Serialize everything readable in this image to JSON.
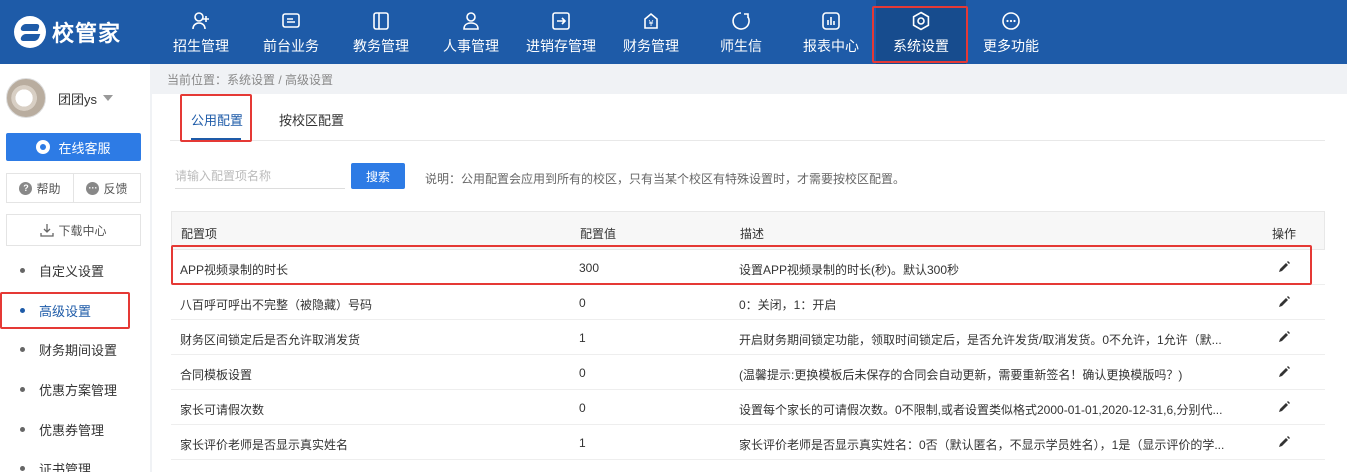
{
  "app": {
    "logo_text": "校管家"
  },
  "nav": {
    "items": [
      {
        "label": "招生管理",
        "icon": "user-plus-icon"
      },
      {
        "label": "前台业务",
        "icon": "screen-icon"
      },
      {
        "label": "教务管理",
        "icon": "book-icon"
      },
      {
        "label": "人事管理",
        "icon": "person-icon"
      },
      {
        "label": "进销存管理",
        "icon": "box-arrow-icon"
      },
      {
        "label": "财务管理",
        "icon": "yen-icon"
      },
      {
        "label": "师生信",
        "icon": "chat-icon"
      },
      {
        "label": "报表中心",
        "icon": "bar-chart-icon"
      },
      {
        "label": "系统设置",
        "icon": "settings-icon",
        "active": true
      },
      {
        "label": "更多功能",
        "icon": "more-icon"
      }
    ]
  },
  "sidebar": {
    "user_name": "团团ys",
    "service_label": "在线客服",
    "help_label": "帮助",
    "feedback_label": "反馈",
    "download_label": "下载中心",
    "menu": [
      {
        "label": "自定义设置"
      },
      {
        "label": "高级设置",
        "active": true
      },
      {
        "label": "财务期间设置"
      },
      {
        "label": "优惠方案管理"
      },
      {
        "label": "优惠券管理"
      },
      {
        "label": "证书管理"
      }
    ]
  },
  "breadcrumb": "当前位置：系统设置 / 高级设置",
  "tabs": [
    {
      "label": "公用配置",
      "active": true
    },
    {
      "label": "按校区配置"
    }
  ],
  "search": {
    "placeholder": "请输入配置项名称",
    "button_label": "搜索",
    "note": "说明：公用配置会应用到所有的校区，只有当某个校区有特殊设置时，才需要按校区配置。"
  },
  "table": {
    "columns": [
      "配置项",
      "配置值",
      "描述",
      "操作"
    ],
    "rows": [
      {
        "name": "APP视频录制的时长",
        "value": "300",
        "desc": "设置APP视频录制的时长(秒)。默认300秒"
      },
      {
        "name": "八百呼可呼出不完整（被隐藏）号码",
        "value": "0",
        "desc": "0：关闭，1：开启"
      },
      {
        "name": "财务区间锁定后是否允许取消发货",
        "value": "1",
        "desc": "开启财务期间锁定功能，领取时间锁定后，是否允许发货/取消发货。0不允许，1允许（默..."
      },
      {
        "name": "合同模板设置",
        "value": "0",
        "desc": "(温馨提示:更换模板后未保存的合同会自动更新，需要重新签名！确认更换模版吗？)"
      },
      {
        "name": "家长可请假次数",
        "value": "0",
        "desc": "设置每个家长的可请假次数。0不限制,或者设置类似格式2000-01-01,2020-12-31,6,分别代..."
      },
      {
        "name": "家长评价老师是否显示真实姓名",
        "value": "1",
        "desc": "家长评价老师是否显示真实姓名：0否（默认匿名，不显示学员姓名），1是（显示评价的学..."
      }
    ]
  }
}
